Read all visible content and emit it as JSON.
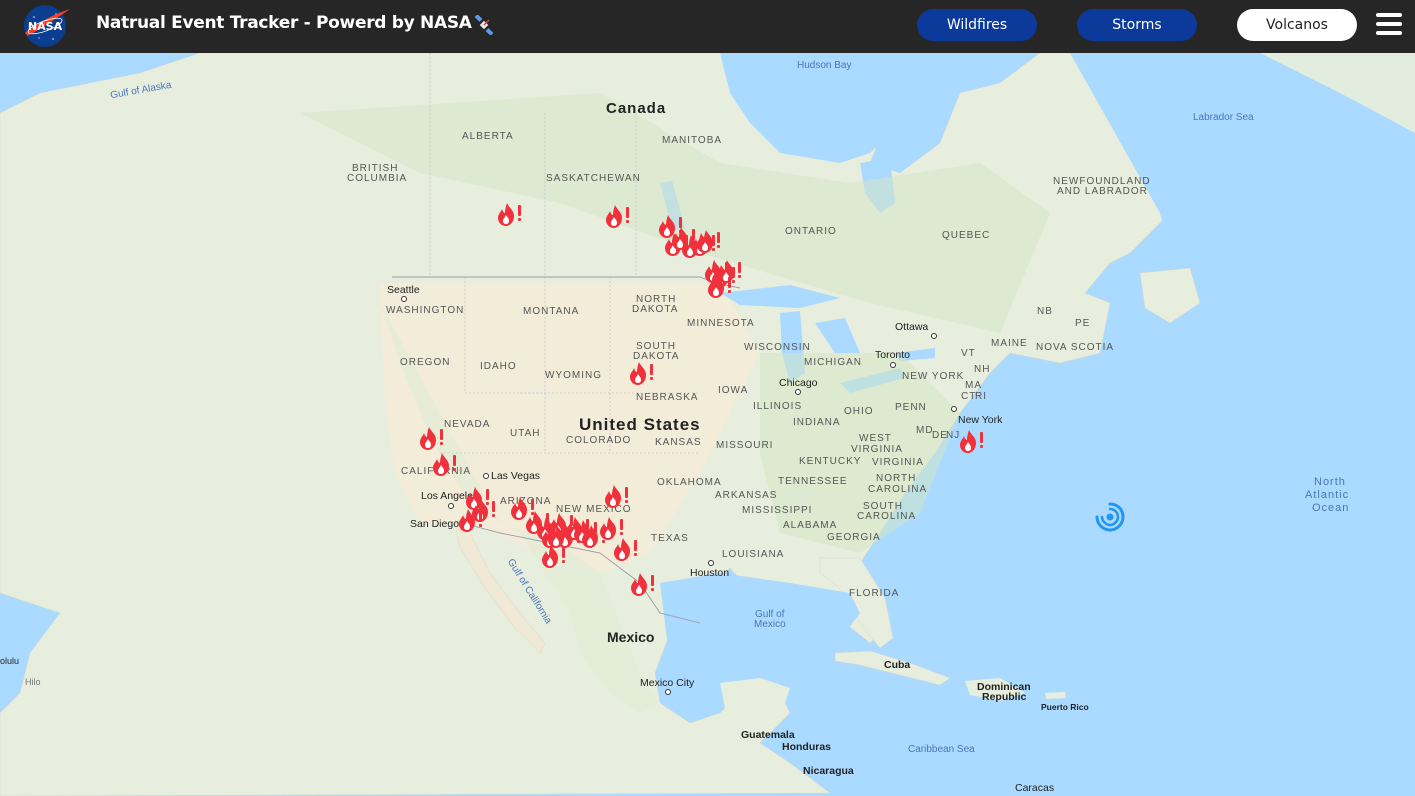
{
  "header": {
    "title": "Natrual Event Tracker - Powerd by NASA",
    "logo_text": "NASA",
    "title_icon": "satellite-icon",
    "buttons": {
      "wildfires": "Wildfires",
      "storms": "Storms",
      "volcanos": "Volcanos"
    },
    "menu_icon": "hamburger-menu-icon"
  },
  "colors": {
    "header_bg": "#262626",
    "btn_blue": "#0b3a9a",
    "wildfire_marker": "#f0303a",
    "storm_marker": "#2196f3",
    "ocean": "#aadaff",
    "land": "#f4efe2"
  },
  "map": {
    "countries": [
      "Canada",
      "United States",
      "Mexico"
    ],
    "states": [
      "ALBERTA",
      "BRITISH",
      "COLUMBIA",
      "SASKATCHEWAN",
      "MANITOBA",
      "ONTARIO",
      "QUEBEC",
      "NEWFOUNDLAND",
      "AND LABRADOR",
      "NB",
      "PE",
      "NOVA SCOTIA",
      "WASHINGTON",
      "MONTANA",
      "NORTH",
      "DAKOTA",
      "SOUTH",
      "DAKOTA",
      "MINNESOTA",
      "OREGON",
      "IDAHO",
      "WYOMING",
      "WISCONSIN",
      "MICHIGAN",
      "NEBRASKA",
      "IOWA",
      "ILLINOIS",
      "NEVADA",
      "UTAH",
      "COLORADO",
      "KANSAS",
      "MISSOURI",
      "INDIANA",
      "OHIO",
      "PENN",
      "CALIFORNIA",
      "ARIZONA",
      "NEW MEXICO",
      "OKLAHOMA",
      "ARKANSAS",
      "TENNESSEE",
      "KENTUCKY",
      "WEST",
      "VIRGINIA",
      "VIRGINIA",
      "NORTH",
      "CAROLINA",
      "SOUTH",
      "CAROLINA",
      "MISSISSIPPI",
      "ALABAMA",
      "GEORGIA",
      "TEXAS",
      "LOUISIANA",
      "FLORIDA",
      "MAINE",
      "VT",
      "NH",
      "MA",
      "CT",
      "RI",
      "NEW YORK",
      "NJ",
      "MD",
      "DE"
    ],
    "cities": [
      "Seattle",
      "Ottawa",
      "Toronto",
      "Chicago",
      "New York",
      "Las Vegas",
      "Los Angeles",
      "San Diego",
      "Houston",
      "Mexico City",
      "Cuba",
      "Dominican",
      "Republic",
      "Puerto Rico",
      "Guatemala",
      "Honduras",
      "Nicaragua",
      "Caracas",
      "olulu",
      "Hilo"
    ],
    "waters": [
      "Gulf of Alaska",
      "Hudson Bay",
      "Labrador Sea",
      "North",
      "Atlantic",
      "Ocean",
      "Gulf of",
      "Mexico",
      "Gulf of California",
      "Caribbean Sea"
    ]
  },
  "events": {
    "wildfire_icon": "fire-alert-icon",
    "storm_icon": "hurricane-icon",
    "wildfire_count": 34,
    "storm_count": 1
  }
}
